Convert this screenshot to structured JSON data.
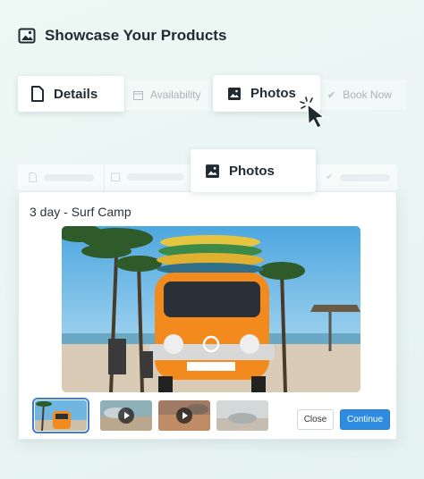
{
  "header": {
    "title": "Showcase Your Products",
    "icon": "image-icon"
  },
  "top_tabs": [
    {
      "label": "Details",
      "icon": "document-icon",
      "state": "card"
    },
    {
      "label": "Availability",
      "icon": "calendar-icon",
      "state": "inactive"
    },
    {
      "label": "Photos",
      "icon": "image-icon",
      "state": "active"
    },
    {
      "label": "Book Now",
      "icon": "check-icon",
      "state": "inactive"
    }
  ],
  "modal": {
    "active_tab": "Photos",
    "title": "3 day - Surf Camp",
    "thumbnails": [
      {
        "kind": "photo",
        "selected": true
      },
      {
        "kind": "video",
        "selected": false
      },
      {
        "kind": "video",
        "selected": false
      },
      {
        "kind": "photo",
        "selected": false
      }
    ],
    "close_label": "Close",
    "continue_label": "Continue"
  },
  "colors": {
    "accent": "#2f8be0",
    "van": "#f28a1e",
    "sky": "#7ec4ea"
  }
}
